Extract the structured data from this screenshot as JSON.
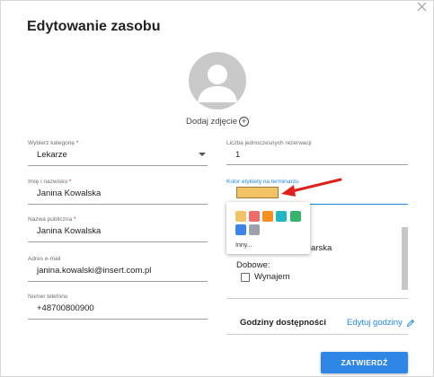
{
  "dialog": {
    "title": "Edytowanie zasobu",
    "add_photo": "Dodaj zdjęcie",
    "submit": "ZATWIERDŹ"
  },
  "left": {
    "category": {
      "label": "Wybierz kategorię",
      "required": "*",
      "value": "Lekarze"
    },
    "name": {
      "label": "Imię i nazwisko",
      "required": "*",
      "value": "Janina Kowalska"
    },
    "public_name": {
      "label": "Nazwa publiczna",
      "required": "*",
      "value": "Janina Kowalska"
    },
    "email": {
      "label": "Adres e-mail",
      "value": "janina.kowalski@insert.com.pl"
    },
    "phone": {
      "label": "Numer telefonu",
      "value": "+48700800900"
    }
  },
  "right": {
    "concurrent": {
      "label": "Liczba jednoczesnych rezerwacji",
      "value": "1"
    },
    "color": {
      "label": "Kolor etykiety na terminarzu",
      "selected": "#f2c266"
    },
    "palette": {
      "colors": [
        "#f2c266",
        "#ef6c6c",
        "#f5901e",
        "#1fb7c4",
        "#35b56b",
        "#3c84e6",
        "#9aa3ad"
      ],
      "other_label": "Inny..."
    },
    "partial_text": "arska",
    "daily_label": "Dobowe:",
    "rent_label": "Wynajem",
    "hours_title": "Godziny dostępności",
    "edit_hours": "Edytuj godziny"
  },
  "colors": {
    "accent": "#1e88e5",
    "button": "#2f86e4",
    "arrow": "#e0201d"
  }
}
